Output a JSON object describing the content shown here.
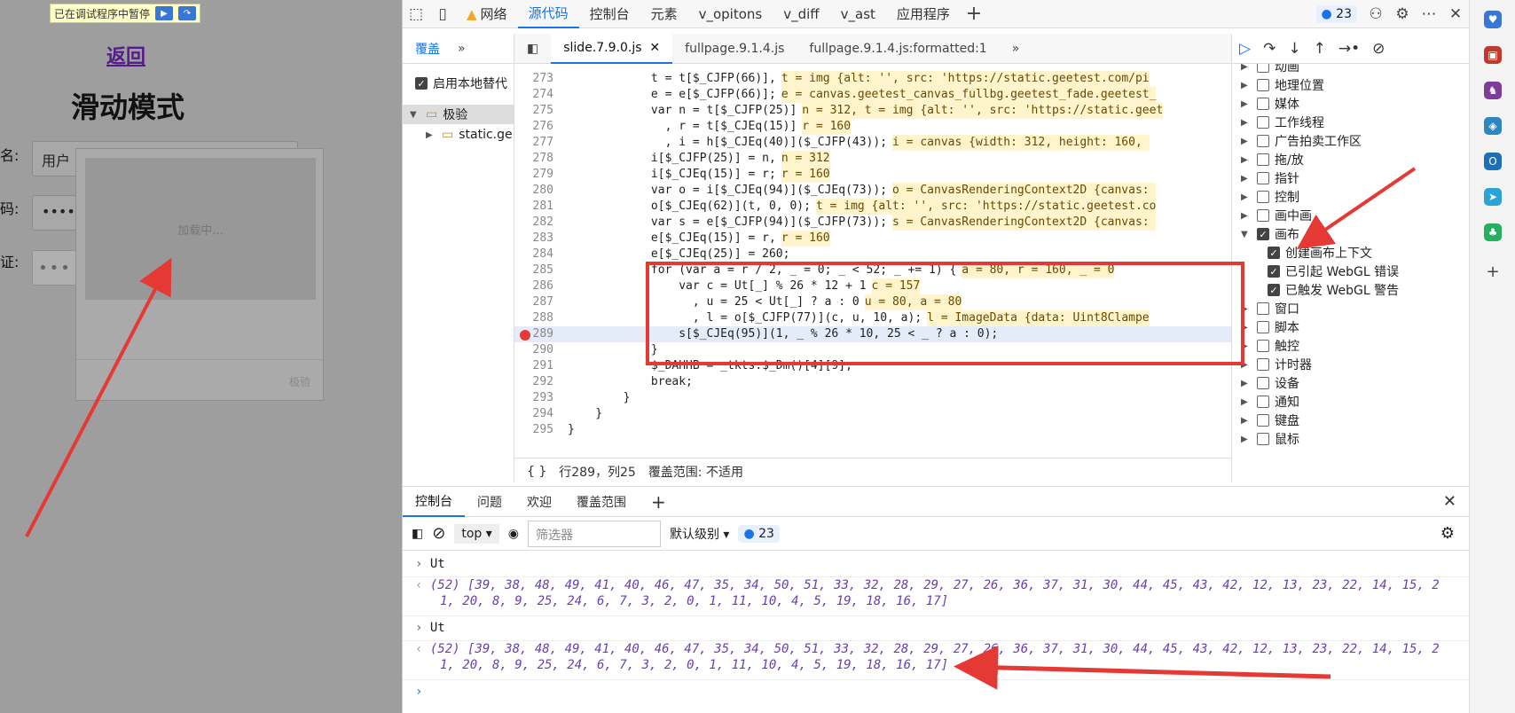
{
  "page": {
    "banner": "已在调试程序中暂停",
    "back": "返回",
    "title": "滑动模式",
    "lbl_name": "名:",
    "lbl_pwd": "码:",
    "lbl_verify": "证:",
    "name_value": "用户",
    "pwd_value": "•••••",
    "loading": "加载中...",
    "brand": "极验",
    "verify_dots": "•••"
  },
  "topbar": {
    "tabs": [
      "网络",
      "源代码",
      "控制台",
      "元素",
      "v_opitons",
      "v_diff",
      "v_ast",
      "应用程序"
    ],
    "issues": "23"
  },
  "left": {
    "tab": "覆盖",
    "override_label": "启用本地替代",
    "folder": "极验",
    "file": "static.ge"
  },
  "editor": {
    "tabs": [
      "slide.7.9.0.js",
      "fullpage.9.1.4.js",
      "fullpage.9.1.4.js:formatted:1"
    ]
  },
  "code": [
    {
      "n": "273",
      "t": "            t = t[$_CJFP(66)],",
      "i": "t = img {alt: '', src: 'https://static.geetest.com/pi"
    },
    {
      "n": "274",
      "t": "            e = e[$_CJFP(66)];",
      "i": "e = canvas.geetest_canvas_fullbg.geetest_fade.geetest_"
    },
    {
      "n": "275",
      "t": "            var n = t[$_CJFP(25)]",
      "i": "n = 312, t = img {alt: '', src: 'https://static.geet"
    },
    {
      "n": "276",
      "t": "              , r = t[$_CJEq(15)]",
      "i": "r = 160"
    },
    {
      "n": "277",
      "t": "              , i = h[$_CJEq(40)]($_CJFP(43));",
      "i": "i = canvas {width: 312, height: 160, "
    },
    {
      "n": "278",
      "t": "            i[$_CJFP(25)] = n,",
      "i": "n = 312"
    },
    {
      "n": "279",
      "t": "            i[$_CJEq(15)] = r;",
      "i": "r = 160"
    },
    {
      "n": "280",
      "t": "            var o = i[$_CJEq(94)]($_CJEq(73));",
      "i": "o = CanvasRenderingContext2D {canvas: "
    },
    {
      "n": "281",
      "t": "            o[$_CJEq(62)](t, 0, 0);",
      "i": "t = img {alt: '', src: 'https://static.geetest.co"
    },
    {
      "n": "282",
      "t": "            var s = e[$_CJFP(94)]($_CJFP(73));",
      "i": "s = CanvasRenderingContext2D {canvas: "
    },
    {
      "n": "283",
      "t": "            e[$_CJEq(15)] = r,",
      "i": "r = 160"
    },
    {
      "n": "284",
      "t": "            e[$_CJEq(25)] = 260;",
      "i": ""
    },
    {
      "n": "285",
      "t": "            for (var a = r / 2, _ = 0; _ < 52; _ += 1) {",
      "i": "a = 80, r = 160, _ = 0"
    },
    {
      "n": "286",
      "t": "                var c = Ut[_] % 26 * 12 + 1",
      "i": "c = 157"
    },
    {
      "n": "287",
      "t": "                  , u = 25 < Ut[_] ? a : 0",
      "i": "u = 80, a = 80"
    },
    {
      "n": "288",
      "t": "                  , l = o[$_CJFP(77)](c, u, 10, a);",
      "i": "l = ImageData {data: Uint8Clampe"
    },
    {
      "n": "289",
      "t": "                s[$_CJEq(95)](1, _ % 26 * 10, 25 < _ ? a : 0);",
      "i": ""
    },
    {
      "n": "290",
      "t": "            }",
      "i": ""
    },
    {
      "n": "291",
      "t": "            $_DAHHB = _tkts.$_Dm()[4][9];",
      "i": ""
    },
    {
      "n": "292",
      "t": "            break;",
      "i": ""
    },
    {
      "n": "293",
      "t": "        }",
      "i": ""
    },
    {
      "n": "294",
      "t": "    }",
      "i": ""
    },
    {
      "n": "295",
      "t": "}",
      "i": ""
    }
  ],
  "status": {
    "pos": "行289，列25",
    "coverage": "覆盖范围: 不适用"
  },
  "breakpoints": [
    {
      "label": "动画",
      "exp": "▶",
      "c": false,
      "indent": 0
    },
    {
      "label": "地理位置",
      "exp": "▶",
      "c": false,
      "indent": 0
    },
    {
      "label": "媒体",
      "exp": "▶",
      "c": false,
      "indent": 0
    },
    {
      "label": "工作线程",
      "exp": "▶",
      "c": false,
      "indent": 0
    },
    {
      "label": "广告拍卖工作区",
      "exp": "▶",
      "c": false,
      "indent": 0
    },
    {
      "label": "拖/放",
      "exp": "▶",
      "c": false,
      "indent": 0
    },
    {
      "label": "指针",
      "exp": "▶",
      "c": false,
      "indent": 0
    },
    {
      "label": "控制",
      "exp": "▶",
      "c": false,
      "indent": 0
    },
    {
      "label": "画中画",
      "exp": "▶",
      "c": false,
      "indent": 0
    },
    {
      "label": "画布",
      "exp": "▼",
      "c": true,
      "indent": 0
    },
    {
      "label": "创建画布上下文",
      "exp": "",
      "c": true,
      "indent": 1
    },
    {
      "label": "已引起 WebGL 错误",
      "exp": "",
      "c": true,
      "indent": 1
    },
    {
      "label": "已触发 WebGL 警告",
      "exp": "",
      "c": true,
      "indent": 1
    },
    {
      "label": "窗口",
      "exp": "▶",
      "c": false,
      "indent": 0
    },
    {
      "label": "脚本",
      "exp": "▶",
      "c": false,
      "indent": 0
    },
    {
      "label": "触控",
      "exp": "▶",
      "c": false,
      "indent": 0
    },
    {
      "label": "计时器",
      "exp": "▶",
      "c": false,
      "indent": 0
    },
    {
      "label": "设备",
      "exp": "▶",
      "c": false,
      "indent": 0
    },
    {
      "label": "通知",
      "exp": "▶",
      "c": false,
      "indent": 0
    },
    {
      "label": "键盘",
      "exp": "▶",
      "c": false,
      "indent": 0
    },
    {
      "label": "鼠标",
      "exp": "▶",
      "c": false,
      "indent": 0
    }
  ],
  "drawer": {
    "tabs": [
      "控制台",
      "问题",
      "欢迎",
      "覆盖范围"
    ],
    "context": "top",
    "filter_placeholder": "筛选器",
    "level": "默认级别",
    "issues": "23"
  },
  "console": {
    "in1": "Ut",
    "out1a": "(52) [39, 38, 48, 49, 41, 40, 46, 47, 35, 34, 50, 51, 33, 32, 28, 29, 27, 26, 36, 37, 31, 30, 44, 45, 43, 42, 12, 13, 23, 22, 14, 15, 2",
    "out1b": "1, 20, 8, 9, 25, 24, 6, 7, 3, 2, 0, 1, 11, 10, 4, 5, 19, 18, 16, 17]",
    "in2": "Ut",
    "out2a": "(52) [39, 38, 48, 49, 41, 40, 46, 47, 35, 34, 50, 51, 33, 32, 28, 29, 27, 26, 36, 37, 31, 30, 44, 45, 43, 42, 12, 13, 23, 22, 14, 15, 2",
    "out2b": "1, 20, 8, 9, 25, 24, 6, 7, 3, 2, 0, 1, 11, 10, 4, 5, 19, 18, 16, 17]"
  },
  "colors": {
    "accent": "#1a73e8",
    "annotation": "#e53935"
  }
}
